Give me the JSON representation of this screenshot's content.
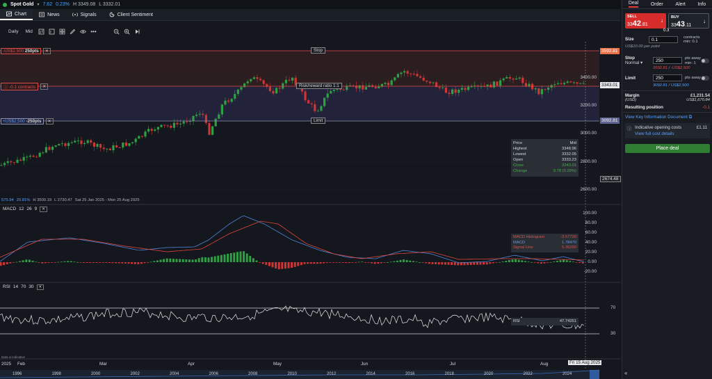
{
  "topbar": {
    "instrument": "Spot Gold",
    "change": "7.62",
    "change_pct": "0.23%",
    "high": "H 3349.08",
    "low": "L 3332.01"
  },
  "tabs": [
    {
      "label": "Chart",
      "icon": "chart-icon"
    },
    {
      "label": "News",
      "icon": "news-icon"
    },
    {
      "label": "Signals",
      "icon": "signals-icon"
    },
    {
      "label": "Client Sentiment",
      "icon": "sentiment-icon"
    }
  ],
  "toolbar": {
    "interval_daily": "Daily",
    "price_mid": "Mid"
  },
  "chart": {
    "stop_tag": "-US$2,500",
    "stop_pts": "250pts",
    "stop_label": "Stop",
    "stop_price": "3592.81",
    "pos_tag": "-0.1 contracts",
    "risk_reward": "Risk/reward ratio 1:1",
    "current_price": "3343.01",
    "limit_tag": "+US$2,500",
    "limit_pts": "-250pts",
    "limit_label": "Limit",
    "limit_price": "3092.81",
    "low_marker": "2674.48",
    "yaxis": [
      "3400.00",
      "3200.00",
      "3000.00",
      "2800.00",
      "2600.00"
    ],
    "range_info": {
      "a": "575.94",
      "b": "20.81%",
      "h": "H 3500.19",
      "l": "L 2730.47",
      "dates": "Sat 25 Jan 2025 - Mon 25 Aug 2025"
    },
    "ohlc_panel": {
      "rows": [
        {
          "k": "Price",
          "v": "Mid"
        },
        {
          "k": "Highest",
          "v": "3348.96"
        },
        {
          "k": "Lowest",
          "v": "3332.05"
        },
        {
          "k": "Open",
          "v": "3333.23"
        },
        {
          "k": "Close",
          "v": "3343.01"
        },
        {
          "k": "Change",
          "v": "9.78 (0.29%)"
        }
      ]
    },
    "x_labels": [
      "2025",
      "Feb",
      "Mar",
      "Apr",
      "May",
      "Jun",
      "Jul",
      "Aug"
    ],
    "x_current": "Fri 15 Aug 2025",
    "nav_years": [
      "1996",
      "1998",
      "2000",
      "2002",
      "2004",
      "2006",
      "2008",
      "2010",
      "2012",
      "2014",
      "2016",
      "2018",
      "2020",
      "2022",
      "2024"
    ],
    "source_note": "Data is indicative"
  },
  "macd": {
    "label": "MACD",
    "params": [
      "12",
      "26",
      "9"
    ],
    "yaxis": [
      "100.00",
      "80.00",
      "60.00",
      "40.00",
      "20.00",
      "0.00",
      "-20.00"
    ],
    "legend": [
      {
        "k": "MACD Histogram",
        "v": "-3.57720"
      },
      {
        "k": "MACD",
        "v": "1.78470"
      },
      {
        "k": "Signal Line",
        "v": "5.36290"
      }
    ]
  },
  "rsi": {
    "label": "RSI",
    "params": [
      "14",
      "70",
      "30"
    ],
    "yaxis": [
      "70",
      "30"
    ],
    "legend": {
      "k": "RSI",
      "v": "47.74251"
    }
  },
  "panel": {
    "tabs": [
      "Deal",
      "Order",
      "Alert",
      "Info"
    ],
    "sell": {
      "label": "SELL",
      "small": "33",
      "big": "42",
      "tail": ".81"
    },
    "buy": {
      "label": "BUY",
      "small": "33",
      "big": "43",
      "tail": ".11"
    },
    "spread": "0.3",
    "size_label": "Size",
    "size_value": "0.1",
    "size_side": "contracts",
    "size_min": "min: 0.1",
    "size_note": "US$10.00 per point",
    "stop_label": "Stop",
    "stop_mode": "Normal",
    "stop_value": "250",
    "stop_side": "pts away",
    "stop_min": "min: 1",
    "stop_note_a": "3592.81",
    "stop_note_b": "-US$2,500",
    "limit_label": "Limit",
    "limit_value": "250",
    "limit_side": "pts away",
    "limit_note_a": "3092.81",
    "limit_note_b": "US$2,500",
    "margin_label": "Margin",
    "margin_ccy": "(USD)",
    "margin_gbp": "£1,231.54",
    "margin_usd": "US$1,670.84",
    "resulting_label": "Resulting position",
    "resulting_value": "-0.1",
    "kid_link": "View Key Information Document",
    "opening_costs": "Indicative opening costs",
    "opening_costs_value": "£1.11",
    "full_cost": "View full cost details",
    "place_deal": "Place deal"
  }
}
